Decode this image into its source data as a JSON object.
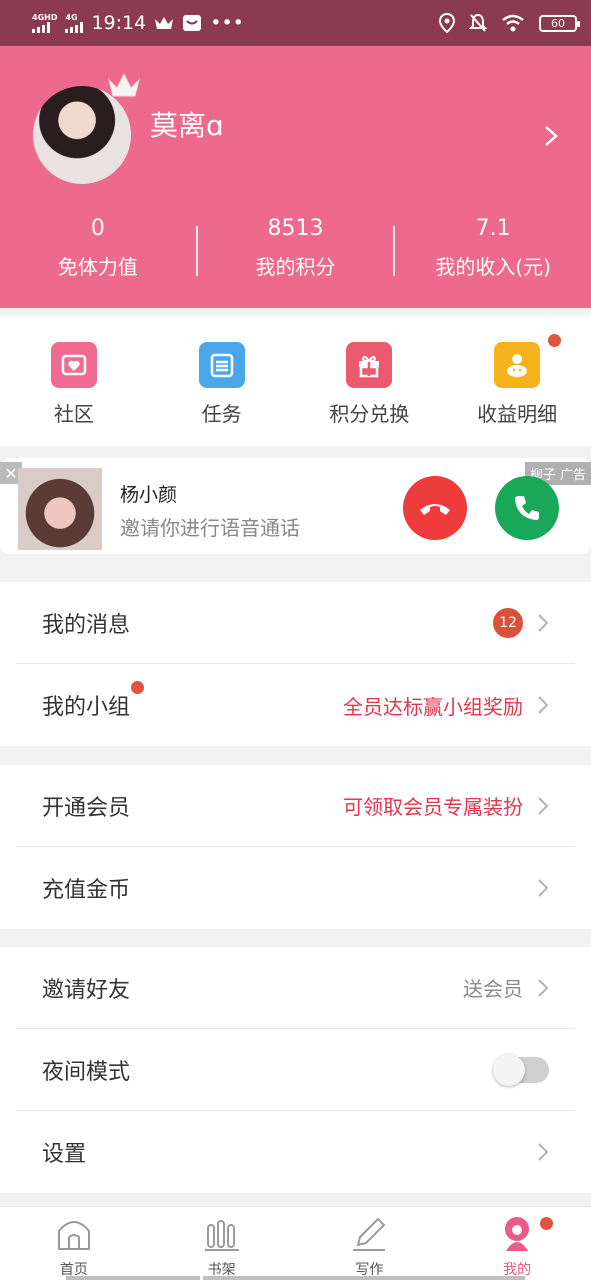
{
  "status_bar": {
    "time": "19:14",
    "network1": "4GHD",
    "network2": "4G",
    "dots": "•••",
    "battery": "60"
  },
  "profile": {
    "username": "莫离ɑ"
  },
  "stats": [
    {
      "value": "0",
      "label": "免体力值"
    },
    {
      "value": "8513",
      "label": "我的积分"
    },
    {
      "value": "7.1",
      "label": "我的收入(元)"
    }
  ],
  "quick_actions": [
    {
      "label": "社区",
      "icon": "community-icon",
      "color": "#f06b92"
    },
    {
      "label": "任务",
      "icon": "task-icon",
      "color": "#4aa8ea"
    },
    {
      "label": "积分兑换",
      "icon": "gift-icon",
      "color": "#ec5a6f"
    },
    {
      "label": "收益明细",
      "icon": "earnings-icon",
      "color": "#f5b21a"
    }
  ],
  "call_ad": {
    "close": "✕",
    "tag": "柳子 广告",
    "name": "杨小颜",
    "subtitle": "邀请你进行语音通话"
  },
  "menu": {
    "messages": {
      "title": "我的消息",
      "badge": "12"
    },
    "group": {
      "title": "我的小组",
      "hint": "全员达标赢小组奖励"
    },
    "vip": {
      "title": "开通会员",
      "hint": "可领取会员专属装扮"
    },
    "recharge": {
      "title": "充值金币"
    },
    "invite": {
      "title": "邀请好友",
      "hint": "送会员"
    },
    "night": {
      "title": "夜间模式",
      "enabled": false
    },
    "settings": {
      "title": "设置"
    }
  },
  "bottom_nav": [
    {
      "label": "首页",
      "icon": "home-icon"
    },
    {
      "label": "书架",
      "icon": "bookshelf-icon"
    },
    {
      "label": "写作",
      "icon": "write-icon"
    },
    {
      "label": "我的",
      "icon": "profile-icon",
      "active": true
    }
  ],
  "colors": {
    "header": "#ed6a8c",
    "status_bar": "#8b3a52",
    "accent_red": "#e1374e"
  }
}
